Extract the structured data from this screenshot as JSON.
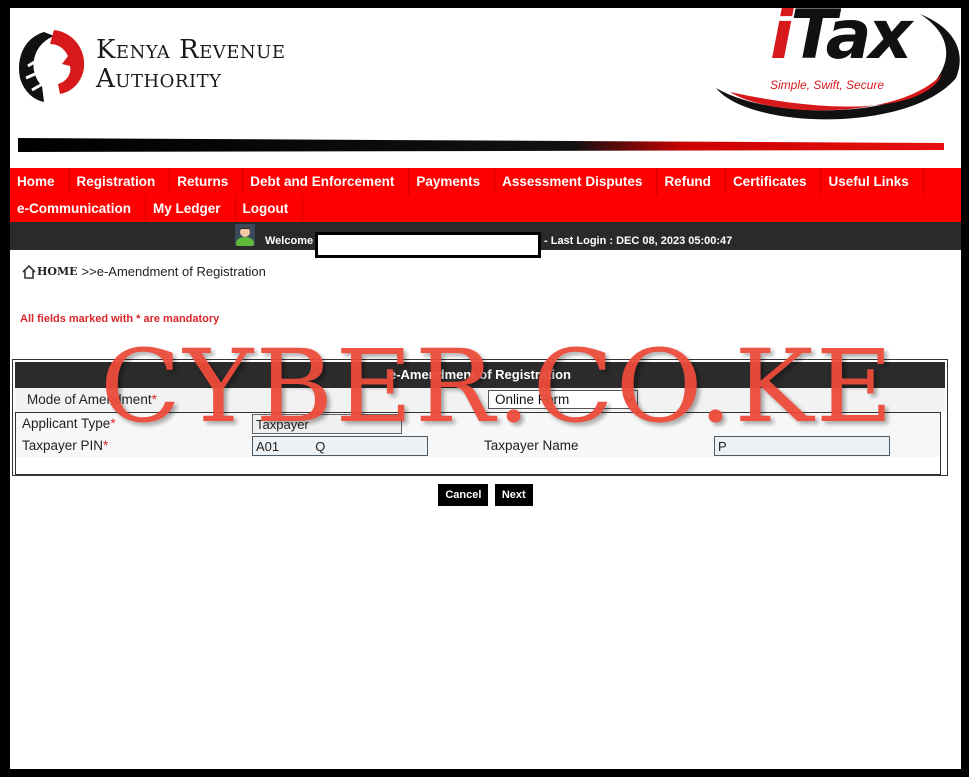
{
  "header": {
    "org_line1": "Kenya Revenue",
    "org_line2": "Authority",
    "itax_word": "Tax",
    "itax_i": "i",
    "itax_tagline": "Simple, Swift, Secure"
  },
  "nav": {
    "row1": [
      {
        "label": "Home"
      },
      {
        "label": "Registration"
      },
      {
        "label": "Returns"
      },
      {
        "label": "Debt and Enforcement"
      },
      {
        "label": "Payments"
      },
      {
        "label": "Assessment Disputes"
      },
      {
        "label": "Refund"
      },
      {
        "label": "Certificates"
      },
      {
        "label": "Useful Links"
      }
    ],
    "row2": [
      {
        "label": "e-Communication"
      },
      {
        "label": "My Ledger"
      },
      {
        "label": "Logout"
      }
    ]
  },
  "welcome": {
    "label": "Welcome",
    "user_name": "",
    "last_login": "- Last Login : DEC 08, 2023 05:00:47"
  },
  "breadcrumb": {
    "home": "HOME",
    "current": ">>e-Amendment of Registration"
  },
  "mandatory_note": "All fields marked with * are mandatory",
  "form": {
    "title": "e-Amendment of Registration",
    "mode_label": "Mode of Amendment",
    "mode_value": "Online Form",
    "applicant_type_label": "Applicant Type",
    "applicant_type_value": "Taxpayer",
    "pin_label": "Taxpayer PIN",
    "pin_value": "A01          Q",
    "name_label": "Taxpayer Name",
    "name_value": "P",
    "required_mark": "*"
  },
  "buttons": {
    "cancel": "Cancel",
    "next": "Next"
  },
  "watermark": "CYBER.CO.KE",
  "colors": {
    "nav_red": "#fe0000",
    "dark_bar": "#2a2a2a",
    "mandatory_red": "#d8262b",
    "watermark": "#ec4b3a"
  }
}
